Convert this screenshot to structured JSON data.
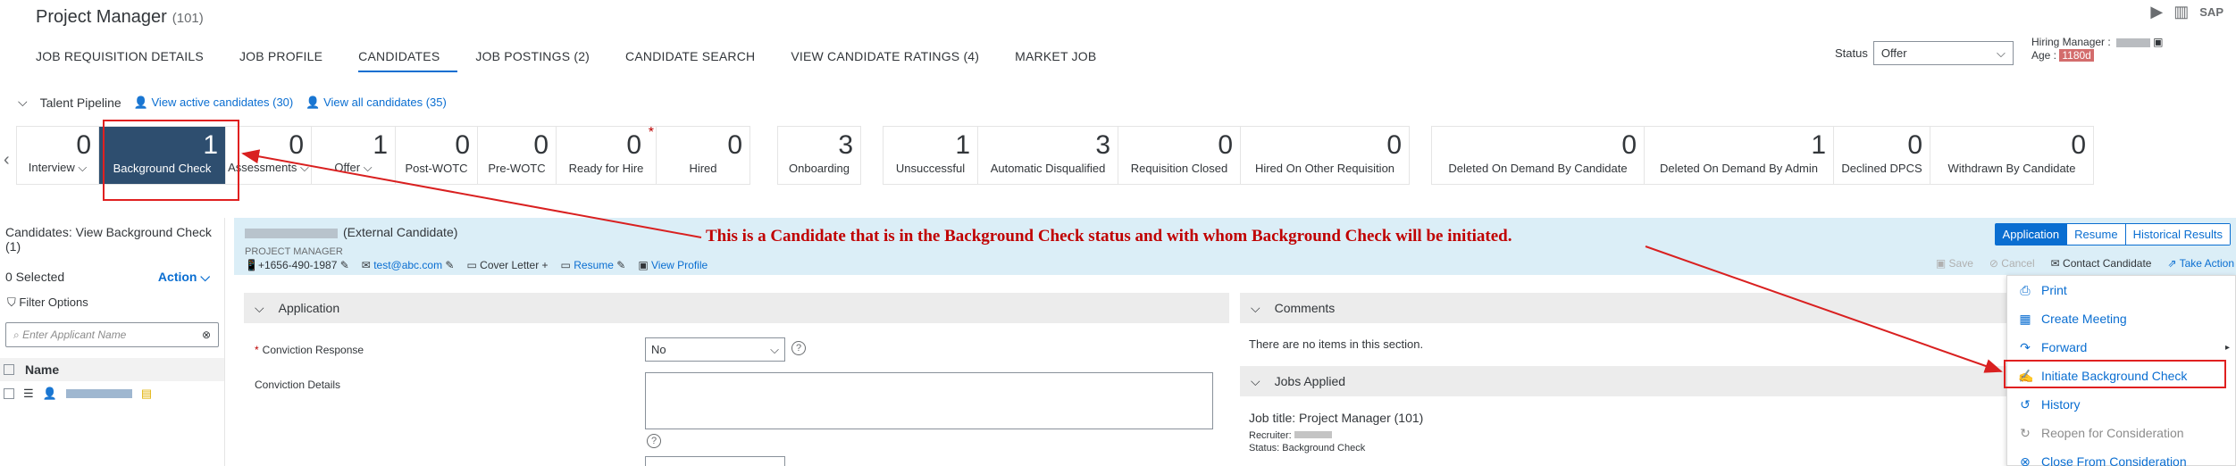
{
  "header": {
    "title": "Project Manager",
    "title_count": "(101)",
    "tabs": [
      "JOB REQUISITION DETAILS",
      "JOB PROFILE",
      "CANDIDATES",
      "JOB POSTINGS (2)",
      "CANDIDATE SEARCH",
      "VIEW CANDIDATE RATINGS (4)",
      "MARKET JOB"
    ],
    "status_label": "Status",
    "status_value": "Offer",
    "hiring_manager_label": "Hiring Manager :",
    "age_label": "Age :",
    "age_value": "1180d",
    "icons": [
      "play-icon",
      "chart-icon",
      "sap-logo"
    ]
  },
  "pipeline": {
    "label": "Talent Pipeline",
    "active_link": "View active candidates (30)",
    "all_link": "View all candidates (35)",
    "stages": [
      {
        "count": "0",
        "label": "Interview"
      },
      {
        "count": "1",
        "label": "Background Check"
      },
      {
        "count": "0",
        "label": "Assessments"
      },
      {
        "count": "1",
        "label": "Offer"
      },
      {
        "count": "0",
        "label": "Post-WOTC"
      },
      {
        "count": "0",
        "label": "Pre-WOTC"
      },
      {
        "count": "0",
        "label": "Ready for Hire"
      },
      {
        "count": "0",
        "label": "Hired"
      },
      {
        "count": "3",
        "label": "Onboarding"
      },
      {
        "count": "1",
        "label": "Unsuccessful"
      },
      {
        "count": "3",
        "label": "Automatic Disqualified"
      },
      {
        "count": "0",
        "label": "Requisition Closed"
      },
      {
        "count": "0",
        "label": "Hired On Other Requisition"
      },
      {
        "count": "0",
        "label": "Deleted On Demand By Candidate"
      },
      {
        "count": "1",
        "label": "Deleted On Demand By Admin"
      },
      {
        "count": "0",
        "label": "Declined DPCS"
      },
      {
        "count": "0",
        "label": "Withdrawn By Candidate"
      }
    ]
  },
  "left_panel": {
    "title": "Candidates: View Background Check (1)",
    "selected": "0 Selected",
    "action": "Action",
    "filter": "Filter Options",
    "search_placeholder": "Enter Applicant Name",
    "name_header": "Name"
  },
  "candidate": {
    "type": "(External Candidate)",
    "role": "PROJECT MANAGER",
    "phone": "+1656-490-1987",
    "email": "test@abc.com",
    "cover_letter": "Cover Letter",
    "resume": "Resume",
    "view_profile": "View Profile",
    "segments": [
      "Application",
      "Resume",
      "Historical Results"
    ],
    "save": "Save",
    "cancel": "Cancel",
    "contact": "Contact Candidate",
    "take_action": "Take Action"
  },
  "application": {
    "section_title": "Application",
    "conviction_response_label": "Conviction Response",
    "conviction_response_value": "No",
    "conviction_details_label": "Conviction Details"
  },
  "right_sections": {
    "comments_title": "Comments",
    "comments_empty": "There are no items in this section.",
    "jobs_applied_title": "Jobs Applied",
    "job_title": "Job title: Project Manager (101)",
    "recruiter_label": "Recruiter:",
    "status_line": "Status: Background Check"
  },
  "menu": {
    "items": [
      {
        "label": "Print",
        "icon": "print-icon",
        "enabled": true
      },
      {
        "label": "Create Meeting",
        "icon": "calendar-icon",
        "enabled": true
      },
      {
        "label": "Forward",
        "icon": "forward-icon",
        "enabled": true
      },
      {
        "label": "Initiate Background Check",
        "icon": "background-check-icon",
        "enabled": true
      },
      {
        "label": "History",
        "icon": "history-icon",
        "enabled": true
      },
      {
        "label": "Reopen for Consideration",
        "icon": "reopen-icon",
        "enabled": false
      },
      {
        "label": "Close From Consideration",
        "icon": "close-circle-icon",
        "enabled": true
      }
    ]
  },
  "annotation": {
    "text": "This is a Candidate that is in the Background Check status and with whom Background Check will be initiated."
  },
  "colors": {
    "accent": "#0a6ed1",
    "active_stage": "#2e4e6f",
    "annotation": "#c00000",
    "candidate_header_bg": "#dbeef7"
  }
}
